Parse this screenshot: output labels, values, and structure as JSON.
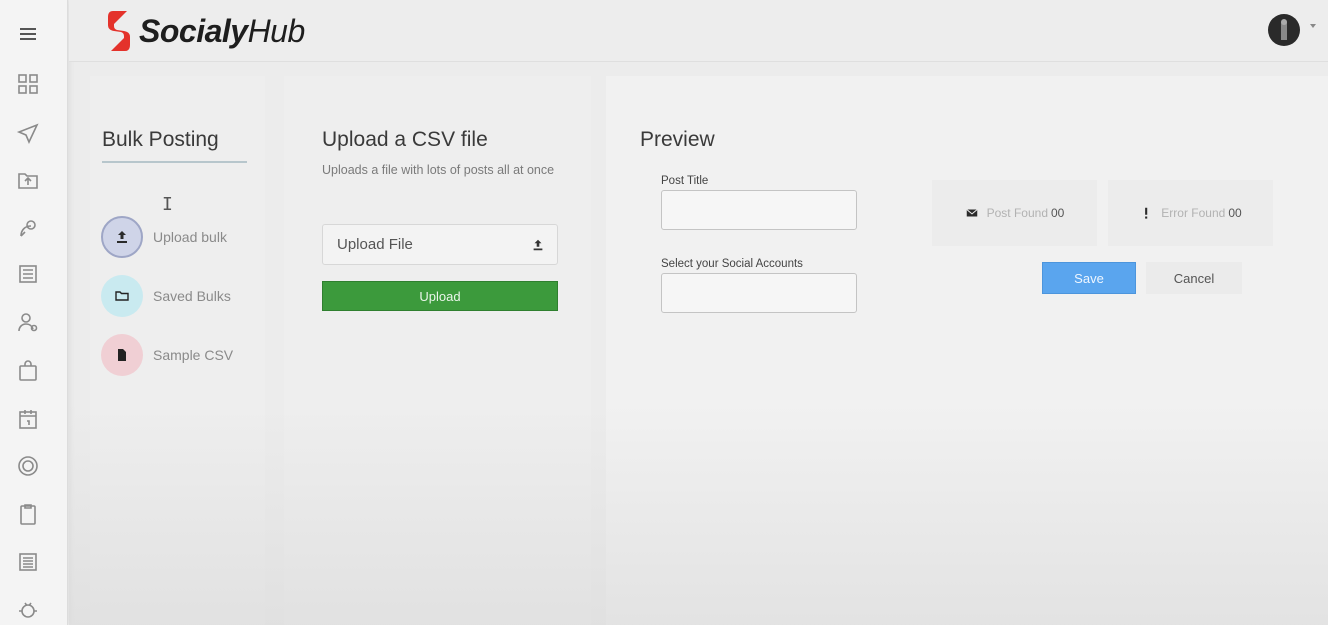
{
  "app": {
    "logo_bold": "Socialy",
    "logo_light": "Hub",
    "brand_color": "#e4322b"
  },
  "rail": {
    "icons": [
      "menu-icon",
      "dashboard-icon",
      "send-icon",
      "folder-upload-icon",
      "satellite-icon",
      "list-icon",
      "user-settings-icon",
      "bag-icon",
      "calendar-icon",
      "target-icon",
      "clipboard-icon",
      "document-list-icon",
      "bug-icon"
    ]
  },
  "bulk": {
    "title": "Bulk Posting",
    "cursor": "I",
    "items": [
      {
        "label": "Upload bulk",
        "icon": "upload-icon"
      },
      {
        "label": "Saved Bulks",
        "icon": "folder-icon"
      },
      {
        "label": "Sample CSV",
        "icon": "file-icon"
      }
    ]
  },
  "upload": {
    "title": "Upload a CSV file",
    "subtitle": "Uploads a file with lots of posts all at once",
    "file_field_label": "Upload File",
    "upload_button": "Upload",
    "upload_color": "#3c9a3c"
  },
  "preview": {
    "title": "Preview",
    "post_title_label": "Post Title",
    "post_title_value": "",
    "accounts_label": "Select your Social Accounts",
    "accounts_value": "",
    "post_found_label": "Post Found",
    "post_found_value": "00",
    "error_found_label": "Error Found",
    "error_found_value": "00",
    "save_button": "Save",
    "cancel_button": "Cancel",
    "save_color": "#5aa5ee"
  }
}
